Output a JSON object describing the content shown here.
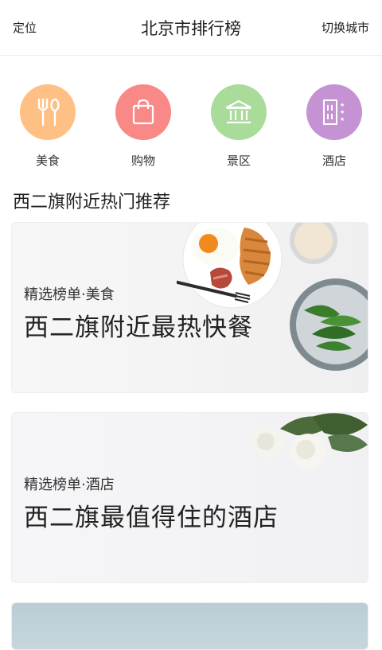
{
  "header": {
    "left_label": "定位",
    "title": "北京市排行榜",
    "right_label": "切换城市"
  },
  "categories": [
    {
      "label": "美食",
      "icon": "fork-spoon-icon",
      "color": "#fec085"
    },
    {
      "label": "购物",
      "icon": "shopping-bag-icon",
      "color": "#f98987"
    },
    {
      "label": "景区",
      "icon": "museum-icon",
      "color": "#a9db9a"
    },
    {
      "label": "酒店",
      "icon": "hotel-icon",
      "color": "#c592d4"
    }
  ],
  "section_title": "西二旗附近热门推荐",
  "cards": [
    {
      "kicker": "精选榜单·美食",
      "headline": "西二旗附近最热快餐"
    },
    {
      "kicker": "精选榜单·酒店",
      "headline": "西二旗最值得住的酒店"
    }
  ]
}
